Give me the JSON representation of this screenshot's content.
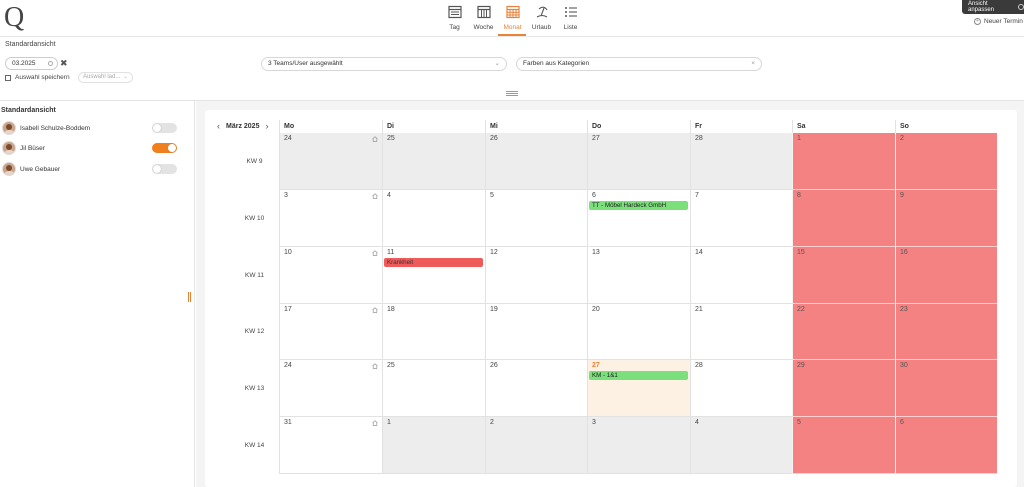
{
  "app": {
    "logo": "Q"
  },
  "views": [
    {
      "label": "Tag",
      "icon": "day-view-icon",
      "active": false
    },
    {
      "label": "Woche",
      "icon": "week-view-icon",
      "active": false
    },
    {
      "label": "Monat",
      "icon": "month-view-icon",
      "active": true
    },
    {
      "label": "Urlaub",
      "icon": "vacation-icon",
      "active": false
    },
    {
      "label": "Liste",
      "icon": "list-view-icon",
      "active": false
    }
  ],
  "header": {
    "tooltip": "Ansicht anpassen",
    "new_appointment": "Neuer Termin"
  },
  "filters": {
    "title": "Standardansicht",
    "date": "03.2025",
    "save_selection": "Auswahl speichern",
    "load_selection_placeholder": "Auswahl lad...",
    "team_select": "3 Teams/User ausgewählt",
    "color_select": "Farben aus Kategorien"
  },
  "sidebar": {
    "title": "Standardansicht",
    "users": [
      {
        "name": "Isabell Schulze-Boddem",
        "active": false
      },
      {
        "name": "Jil Büser",
        "active": true
      },
      {
        "name": "Uwe Gebauer",
        "active": false
      }
    ]
  },
  "calendar": {
    "month_title": "März 2025",
    "weekdays": [
      "Mo",
      "Di",
      "Mi",
      "Do",
      "Fr",
      "Sa",
      "So"
    ],
    "weeks": [
      {
        "label": "KW 9",
        "days": [
          "24",
          "25",
          "26",
          "27",
          "28",
          "1",
          "2"
        ]
      },
      {
        "label": "KW 10",
        "days": [
          "3",
          "4",
          "5",
          "6",
          "7",
          "8",
          "9"
        ]
      },
      {
        "label": "KW 11",
        "days": [
          "10",
          "11",
          "12",
          "13",
          "14",
          "15",
          "16"
        ]
      },
      {
        "label": "KW 12",
        "days": [
          "17",
          "18",
          "19",
          "20",
          "21",
          "22",
          "23"
        ]
      },
      {
        "label": "KW 13",
        "days": [
          "24",
          "25",
          "26",
          "27",
          "28",
          "29",
          "30"
        ]
      },
      {
        "label": "KW 14",
        "days": [
          "31",
          "1",
          "2",
          "3",
          "4",
          "5",
          "6"
        ]
      }
    ],
    "events": [
      {
        "week": 1,
        "day": 3,
        "label": "TT - Möbel Hardeck GmbH",
        "color": "green"
      },
      {
        "week": 2,
        "day": 1,
        "label": "Krankheit",
        "color": "red"
      },
      {
        "week": 4,
        "day": 3,
        "label": "KM - 1&1",
        "color": "green"
      }
    ],
    "today": {
      "week": 4,
      "day": 3
    },
    "colors": {
      "weekend": "#f58282",
      "outside": "#ededed",
      "today": "#fdf1e4",
      "accent": "#e9833a"
    }
  }
}
